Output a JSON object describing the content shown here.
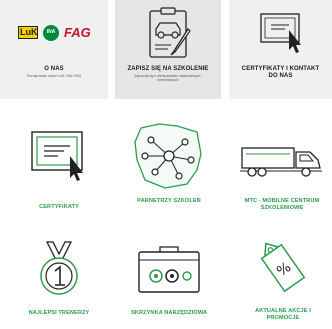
{
  "top_tiles": [
    {
      "title": "O NAS",
      "subtitle": "Poznaj nasze marki: LuK, INA i FAG"
    },
    {
      "title": "ZAPISZ SIĘ NA SZKOLENIE",
      "subtitle": "Zapoznaj się z ofertą szkoleń stacjonarnych i internetowych"
    },
    {
      "title": "CERTYFIKATY I KONTAKT DO NAS"
    }
  ],
  "logos": {
    "luk": "LuK",
    "ina": "INA",
    "fag": "FAG"
  },
  "cards": [
    {
      "label": "CERTYFIKATY",
      "icon": "certificate-icon"
    },
    {
      "label": "PARNETRZY SZKOLEŃ",
      "icon": "poland-map-network-icon"
    },
    {
      "label": "MTC - MOBILNE CENTRUM SZKOLENIOWE",
      "icon": "truck-icon"
    },
    {
      "label": "NAJLEPSI TRENERZY",
      "icon": "medal-icon"
    },
    {
      "label": "SKRZYNKA NARZĘDZIOWA",
      "icon": "toolbox-icon"
    },
    {
      "label": "AKTUALNE AKCJE I PROMOCJE",
      "icon": "percent-tag-icon"
    }
  ],
  "colors": {
    "accent": "#2a9d4a",
    "fag": "#c8102e",
    "luk_yellow": "#f5d000",
    "ina_green": "#00893d"
  }
}
